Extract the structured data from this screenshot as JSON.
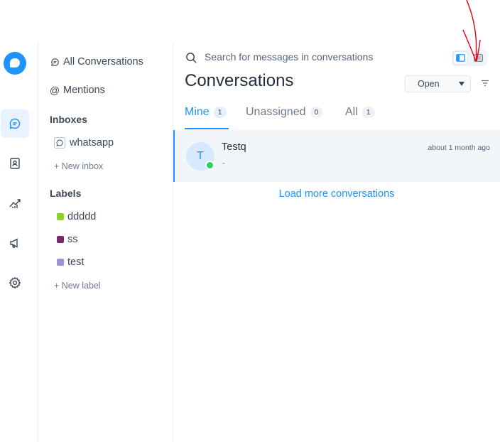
{
  "colors": {
    "brand": "#1f93ff",
    "annotation": "#e3000f"
  },
  "rail": {
    "items": [
      {
        "icon": "chat-icon",
        "active": true
      },
      {
        "icon": "contacts-icon",
        "active": false
      },
      {
        "icon": "reports-icon",
        "active": false
      },
      {
        "icon": "campaigns-icon",
        "active": false
      },
      {
        "icon": "settings-icon",
        "active": false
      }
    ]
  },
  "sidebar": {
    "all_conversations": "All Conversations",
    "mentions": "Mentions",
    "inboxes_heading": "Inboxes",
    "inboxes": [
      {
        "label": "whatsapp",
        "icon": "whatsapp-icon"
      }
    ],
    "new_inbox": "New inbox",
    "labels_heading": "Labels",
    "labels": [
      {
        "label": "ddddd",
        "color": "#8bd12b"
      },
      {
        "label": "ss",
        "color": "#7b2a68"
      },
      {
        "label": "test",
        "color": "#a490cf"
      }
    ],
    "new_label": "New label"
  },
  "main": {
    "search_placeholder": "Search for messages in conversations",
    "title": "Conversations",
    "status_filter": "Open",
    "tabs": [
      {
        "label": "Mine",
        "count": "1"
      },
      {
        "label": "Unassigned",
        "count": "0"
      },
      {
        "label": "All",
        "count": "1"
      }
    ],
    "conversations": [
      {
        "avatar_initial": "T",
        "name": "Testq",
        "preview": "-",
        "time": "about 1 month ago",
        "channel": "whatsapp"
      }
    ],
    "load_more": "Load more conversations"
  }
}
